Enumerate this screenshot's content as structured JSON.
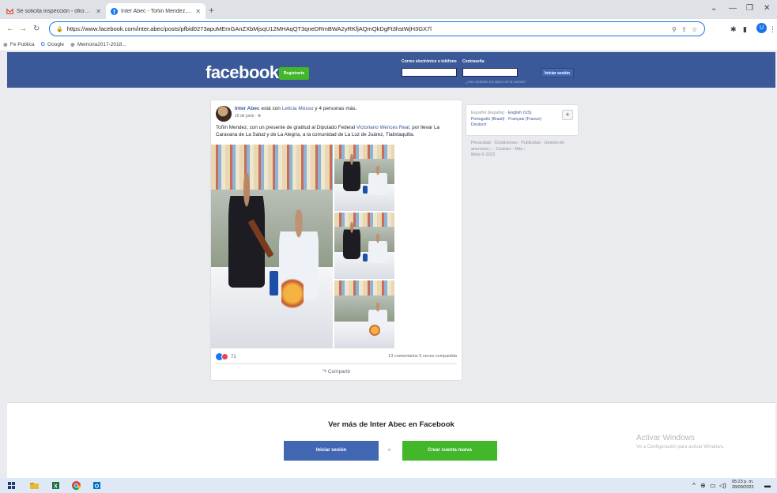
{
  "browser": {
    "tabs": [
      {
        "title": "Se solicita inspección - oficialia.c",
        "close": "✕"
      },
      {
        "title": "Inter Abec - Toñin Mendez, con ...",
        "close": "✕"
      }
    ],
    "new_tab": "+",
    "address": "https://www.facebook.com/inter.abec/posts/pfbid0273apuMEmGAnZXbMjsqU12MHAqQT3qneDRmBWA2yRKfjAQmQkDgFt3hstWjH3GX7l",
    "bookmarks": [
      "Fe Publica",
      "Google",
      "Memoria2017-2018..."
    ]
  },
  "fb_header": {
    "logo": "facebook",
    "register": "Registrarte",
    "email_label": "Correo electrónico o teléfono",
    "password_label": "Contraseña",
    "forgot": "¿Has olvidado los datos de la cuenta?",
    "login": "Iniciar sesión"
  },
  "post": {
    "author": "Inter Abec",
    "with_text": " está con ",
    "tagged": "Leticia Mosso",
    "others": " y 4 personas más.",
    "date": "10 de junio · ⊕",
    "text_1": "Toñin Mendez, con un presente de gratitud al Diputado Federal ",
    "text_link": "Victoriano Wences Real",
    "text_2": ", por llevar La Caravana de La Salud y de La Alegría, a la comunidad de La Luz de Juárez, Tlalixtaquilla.",
    "reactions_count": "71",
    "counts": "13 comentarios  5 veces compartida",
    "share": "↷ Compartir"
  },
  "sidebar": {
    "languages_current": "Español (España) · ",
    "lang_links": [
      "English (US)",
      "Português (Brasil)",
      "Français (France)",
      "Deutsch"
    ],
    "plus": "+",
    "footer": "Privacidad · Condiciones · Publicidad · Gestión de anuncios ▷ · Cookies · Más ›",
    "meta": "Meta © 2022"
  },
  "banner": {
    "title": "Ver más de Inter Abec en Facebook",
    "login": "Iniciar sesión",
    "or": "o",
    "create": "Crear cuenta nueva"
  },
  "watermark": {
    "title": "Activar Windows",
    "subtitle": "Ve a Configuración para activar Windows."
  },
  "taskbar": {
    "time": "05:23 p. m.",
    "date": "28/09/2022"
  },
  "colors": {
    "fb_blue": "#3b5998",
    "fb_green": "#42b72a",
    "link": "#385898"
  }
}
